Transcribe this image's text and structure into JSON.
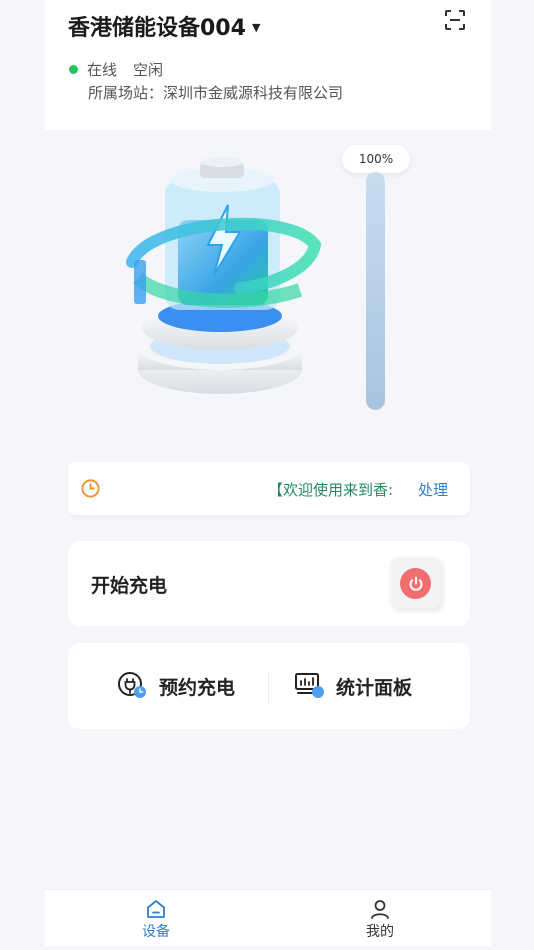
{
  "header": {
    "device_name": "香港储能设备004",
    "status_online": "在线",
    "status_state": "空闲",
    "station": "所属场站：深圳市金威源科技有限公司"
  },
  "gauge": {
    "label": "100%",
    "level": 1.0
  },
  "notice": {
    "text": "【欢迎使用来到香:",
    "action": "处理"
  },
  "charge": {
    "label": "开始充电"
  },
  "actions": {
    "reserve": "预约充电",
    "stats": "统计面板"
  },
  "nav": {
    "device": "设备",
    "mine": "我的"
  },
  "colors": {
    "accent": "#2f7fd1",
    "online": "#22c55e",
    "power": "#f26d6d",
    "clock": "#f0962c"
  },
  "icons": {
    "scan": "scan-icon",
    "clock": "clock-icon",
    "power": "power-icon",
    "reserve": "plug-clock-icon",
    "stats": "monitor-chart-icon",
    "home": "home-icon",
    "user": "user-icon"
  }
}
